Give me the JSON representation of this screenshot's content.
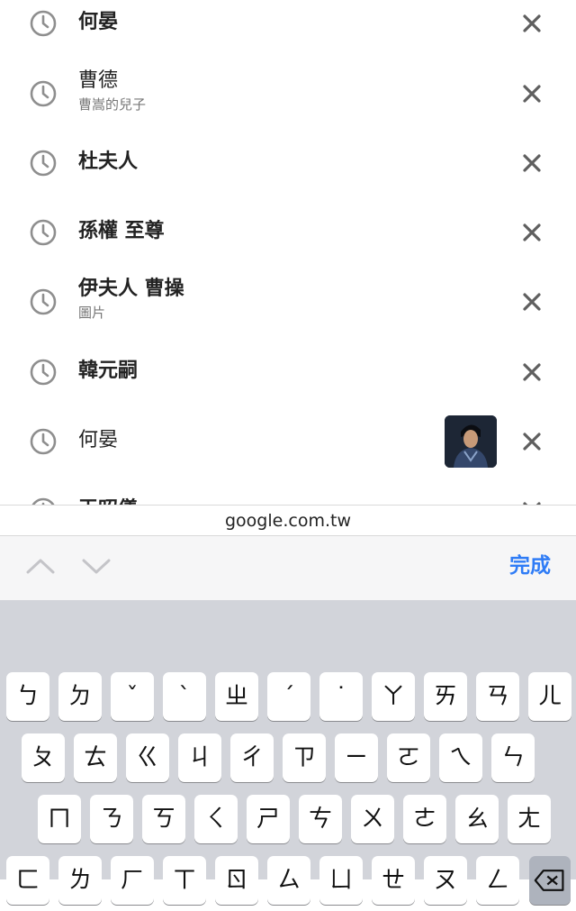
{
  "history": [
    {
      "title": "何晏",
      "subtitle": "",
      "bold": true,
      "thumbnail": false
    },
    {
      "title": "曹德",
      "subtitle": "曹嵩的兒子",
      "bold": false,
      "thumbnail": false
    },
    {
      "title": "杜夫人",
      "subtitle": "",
      "bold": true,
      "thumbnail": false
    },
    {
      "title": "孫權 至尊",
      "subtitle": "",
      "bold": true,
      "thumbnail": false
    },
    {
      "title": "伊夫人 曹操",
      "subtitle": "圖片",
      "bold": true,
      "thumbnail": false
    },
    {
      "title": "韓元嗣",
      "subtitle": "",
      "bold": true,
      "thumbnail": false
    },
    {
      "title": "何晏",
      "subtitle": "",
      "bold": false,
      "thumbnail": true
    },
    {
      "title": "王昭儀",
      "subtitle": "",
      "bold": true,
      "thumbnail": false
    }
  ],
  "icons": {
    "history": "clock-icon",
    "remove": "close-icon",
    "prev": "chevron-up-icon",
    "next": "chevron-down-icon",
    "delete": "backspace-icon"
  },
  "domain": "google.com.tw",
  "accessory": {
    "done_label": "完成"
  },
  "colors": {
    "accent": "#2f7cf6",
    "keyboard_bg": "#d2d4da",
    "key_bg": "#ffffff"
  },
  "keyboard": {
    "row1": [
      "ㄅ",
      "ㄉ",
      "ˇ",
      "ˋ",
      "ㄓ",
      "ˊ",
      "˙",
      "ㄚ",
      "ㄞ",
      "ㄢ",
      "ㄦ"
    ],
    "row2": [
      "ㄆ",
      "ㄊ",
      "ㄍ",
      "ㄐ",
      "ㄔ",
      "ㄗ",
      "ㄧ",
      "ㄛ",
      "ㄟ",
      "ㄣ"
    ],
    "row3": [
      "ㄇ",
      "ㄋ",
      "ㄎ",
      "ㄑ",
      "ㄕ",
      "ㄘ",
      "ㄨ",
      "ㄜ",
      "ㄠ",
      "ㄤ"
    ],
    "row4": [
      "ㄈ",
      "ㄌ",
      "ㄏ",
      "ㄒ",
      "ㄖ",
      "ㄙ",
      "ㄩ",
      "ㄝ",
      "ㄡ",
      "ㄥ"
    ]
  }
}
